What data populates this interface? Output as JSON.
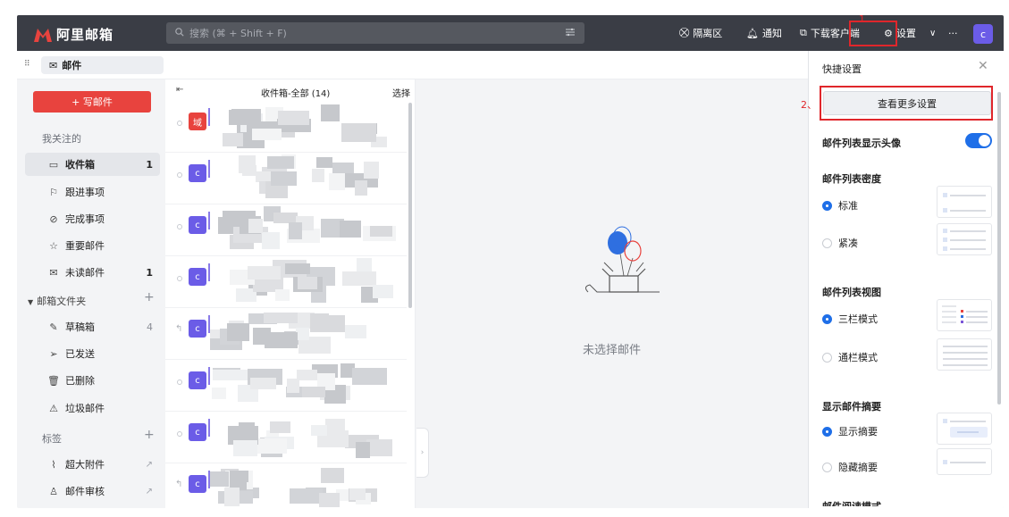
{
  "app": {
    "logo_text": "阿里邮箱",
    "brand_color": "#e8433e",
    "topbar_color": "#3a3d45"
  },
  "search": {
    "placeholder": "搜索 (⌘ + Shift + F)"
  },
  "topnav": {
    "quarantine": "隔离区",
    "notify": "通知",
    "download": "下载客户端",
    "settings": "设置",
    "more": "···",
    "avatar": "c"
  },
  "annotations": {
    "step1": "1",
    "step2": "2、"
  },
  "subbar": {
    "mail_tab": "邮件"
  },
  "sidebar": {
    "compose": "+ 写邮件",
    "followed_label": "我关注的",
    "items": [
      {
        "label": "收件箱",
        "count": "1"
      },
      {
        "label": "跟进事项"
      },
      {
        "label": "完成事项"
      },
      {
        "label": "重要邮件"
      },
      {
        "label": "未读邮件",
        "count": "1"
      }
    ],
    "folders_label": "邮箱文件夹",
    "folders": [
      {
        "label": "草稿箱",
        "count": "4"
      },
      {
        "label": "已发送"
      },
      {
        "label": "已删除"
      },
      {
        "label": "垃圾邮件"
      }
    ],
    "tags_label": "标签",
    "extras": [
      {
        "label": "超大附件"
      },
      {
        "label": "邮件审核"
      }
    ]
  },
  "list": {
    "title": "收件箱-全部 (14)",
    "select": "选择",
    "rows": [
      {
        "badge": "域",
        "badge_color": "#e8433e"
      },
      {
        "badge": "c",
        "badge_color": "#6b5ce7"
      },
      {
        "badge": "c",
        "badge_color": "#6b5ce7"
      },
      {
        "badge": "c",
        "badge_color": "#6b5ce7"
      },
      {
        "badge": "c",
        "badge_color": "#6b5ce7"
      },
      {
        "badge": "c",
        "badge_color": "#6b5ce7"
      },
      {
        "badge": "c",
        "badge_color": "#6b5ce7"
      },
      {
        "badge": "c",
        "badge_color": "#6b5ce7"
      }
    ]
  },
  "preview": {
    "empty": "未选择邮件"
  },
  "panel": {
    "title": "快捷设置",
    "more_settings": "查看更多设置",
    "avatar_setting": "邮件列表显示头像",
    "avatar_enabled": true,
    "density_label": "邮件列表密度",
    "density_standard": "标准",
    "density_compact": "紧凑",
    "view_label": "邮件列表视图",
    "view_three": "三栏模式",
    "view_full": "通栏模式",
    "summary_label": "显示邮件摘要",
    "summary_show": "显示摘要",
    "summary_hide": "隐藏摘要",
    "reading_label": "邮件阅读模式"
  }
}
